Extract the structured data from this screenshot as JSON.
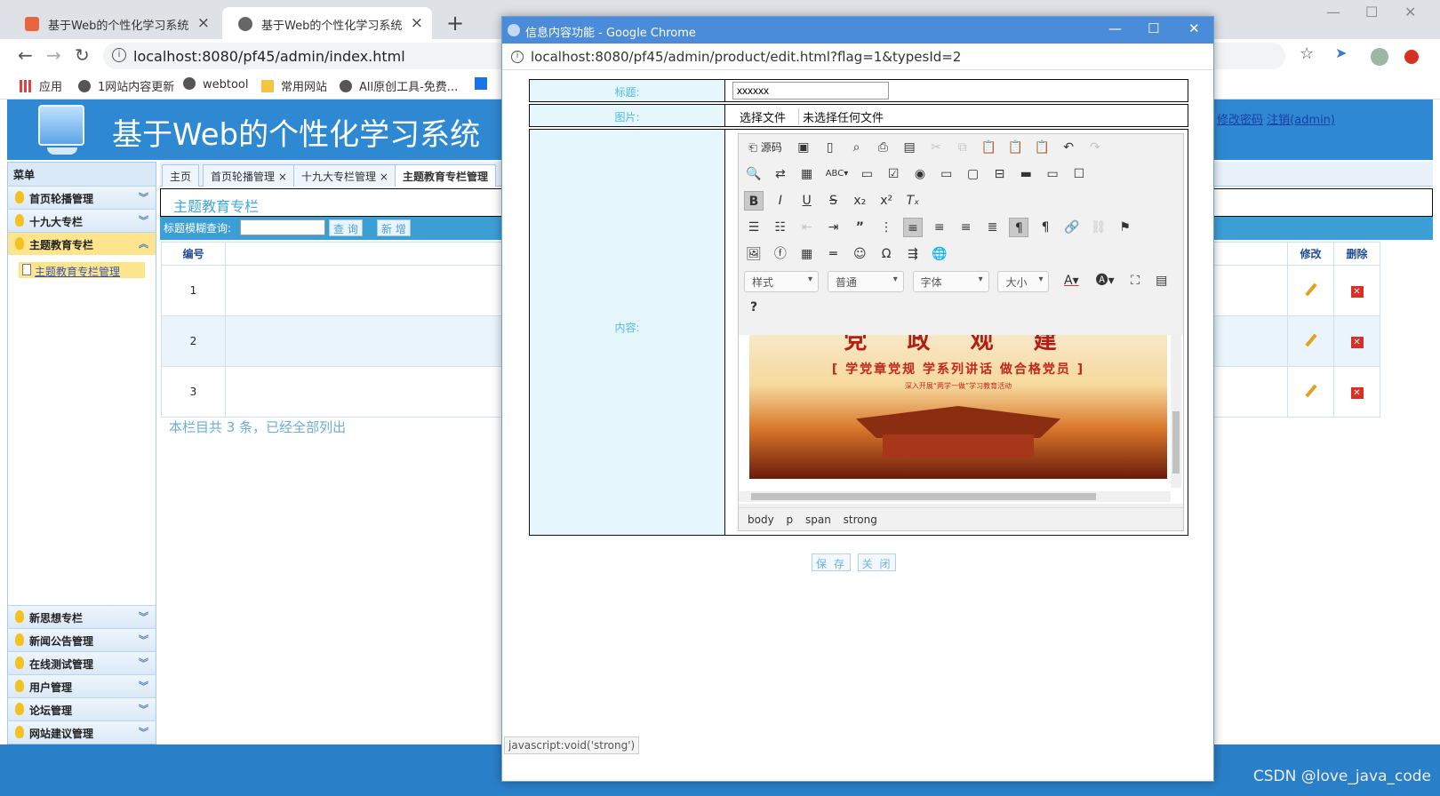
{
  "browser": {
    "tabs": [
      {
        "title": "基于Web的个性化学习系统",
        "active": false
      },
      {
        "title": "基于Web的个性化学习系统",
        "active": true
      }
    ],
    "url": "localhost:8080/pf45/admin/index.html",
    "bookmarks": [
      "应用",
      "1网站内容更新",
      "webtool",
      "常用网站",
      "All原创工具-免费..."
    ]
  },
  "app": {
    "title": "基于Web的个性化学习系统",
    "header_links": [
      "修改密码",
      "注销(admin)"
    ],
    "menu_title": "菜单",
    "menu_top": [
      {
        "label": "首页轮播管理",
        "open": false
      },
      {
        "label": "十九大专栏",
        "open": false
      },
      {
        "label": "主题教育专栏",
        "open": true
      }
    ],
    "submenu": "主题教育专栏管理",
    "menu_bottom": [
      "新思想专栏",
      "新闻公告管理",
      "在线测试管理",
      "用户管理",
      "论坛管理",
      "网站建议管理"
    ],
    "page_tabs": [
      "主页",
      "首页轮播管理",
      "十九大专栏管理",
      "主题教育专栏管理"
    ],
    "section_title": "主题教育专栏",
    "search_label": "标题模糊查询:",
    "search_button": "查 询",
    "add_button": "新 增",
    "table": {
      "headers": {
        "id": "编号",
        "edit": "修改",
        "delete": "删除"
      },
      "rows": [
        "1",
        "2",
        "3"
      ]
    },
    "summary": "本栏目共 3 条，已经全部列出"
  },
  "popup": {
    "window_title": "信息内容功能 - Google Chrome",
    "url": "localhost:8080/pf45/admin/product/edit.html?flag=1&typesId=2",
    "form": {
      "title_label": "标题:",
      "title_value": "xxxxxx",
      "image_label": "图片:",
      "file_button": "选择文件",
      "file_status": "未选择任何文件",
      "content_label": "内容:"
    },
    "editor": {
      "source_label": "源码",
      "format_selects": [
        "样式",
        "普通",
        "字体",
        "大小"
      ],
      "banner_big": "党 政 观 建",
      "banner_slogan": "[ 学党章党规  学系列讲话  做合格党员 ]",
      "banner_sub": "深入开展“两学一做”学习教育活动",
      "path": [
        "body",
        "p",
        "span",
        "strong"
      ]
    },
    "save_button": "保 存",
    "close_button": "关 闭",
    "status": "javascript:void('strong')"
  },
  "watermark": "CSDN @love_java_code",
  "colors": {
    "accent": "#2f89d2",
    "popup_title": "#4a8cd9",
    "label_bg": "#e6f6fd"
  }
}
